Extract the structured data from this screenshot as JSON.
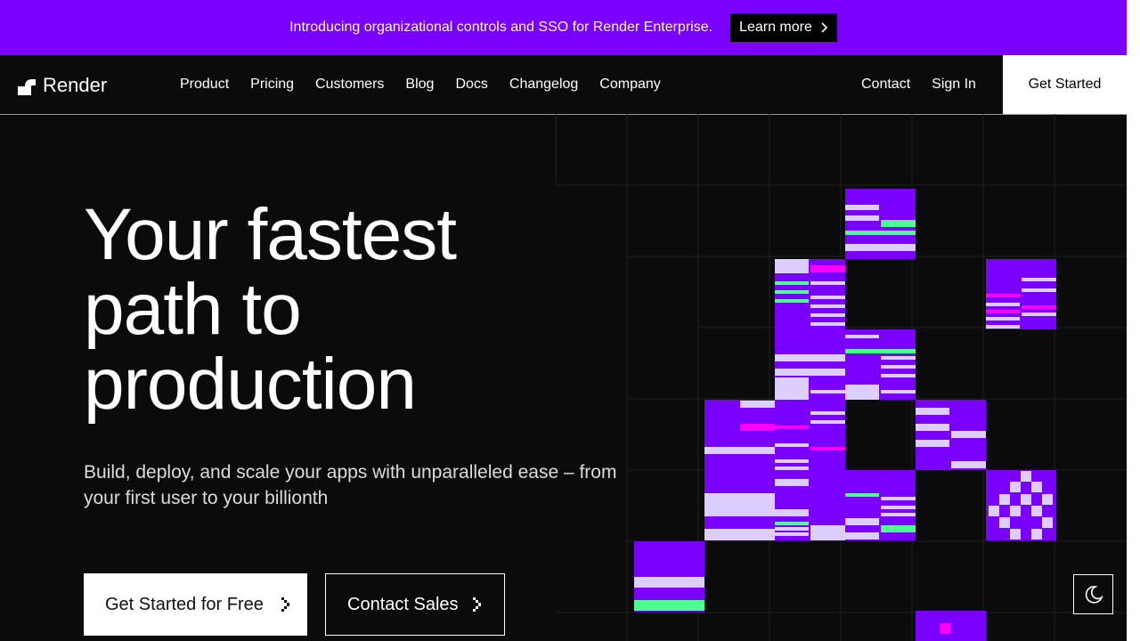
{
  "banner": {
    "text": "Introducing organizational controls and SSO for Render Enterprise.",
    "cta_label": "Learn more"
  },
  "nav": {
    "logo_text": "Render",
    "links": [
      "Product",
      "Pricing",
      "Customers",
      "Blog",
      "Docs",
      "Changelog",
      "Company"
    ],
    "contact_label": "Contact",
    "signin_label": "Sign In",
    "get_started_label": "Get Started"
  },
  "hero": {
    "title_lines": [
      "Your fastest",
      "path to",
      "production"
    ],
    "subtitle": "Build, deploy, and scale your apps with unparalleled ease – from your first user to your billionth",
    "primary_cta": "Get Started for Free",
    "secondary_cta": "Contact Sales"
  },
  "colors": {
    "brand_purple": "#7a00ff",
    "accent_green": "#4dff91",
    "accent_magenta": "#ff00ff",
    "lavender": "#dccfff",
    "background": "#0b0b0b"
  },
  "icons": {
    "theme_toggle": "moon-icon",
    "chevron": "chevron-right-icon"
  }
}
